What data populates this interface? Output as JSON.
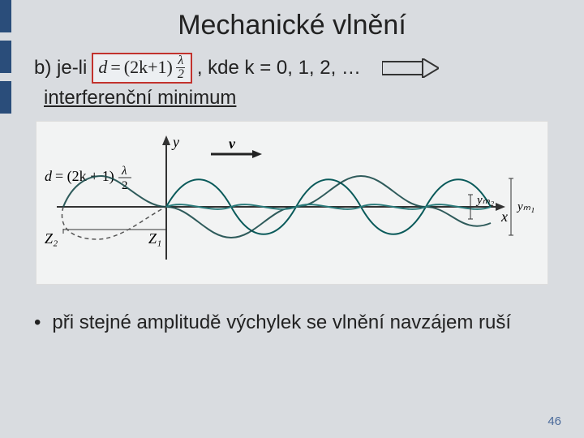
{
  "title": "Mechanické vlnění",
  "line1_prefix": "b) je-li",
  "formula": {
    "lhs": "d",
    "eq": "=",
    "factor": "(2k+1)",
    "frac_top": "λ",
    "frac_bot": "2"
  },
  "line1_suffix": ", kde k = 0, 1, 2, …",
  "line2": "interferenční minimum",
  "diagram": {
    "y_axis": "y",
    "x_axis": "x",
    "v_label": "v",
    "d_formula_lhs": "d",
    "d_formula_factor": "= (2k + 1)",
    "d_formula_frac_top": "λ",
    "d_formula_frac_bot": "2",
    "z1": "Z₁",
    "z2": "Z₂",
    "ym1": "yₘ₁",
    "ym2": "yₘ₂"
  },
  "bullet": "při stejné amplitudě výchylek se vlnění navzájem ruší",
  "page_number": "46"
}
